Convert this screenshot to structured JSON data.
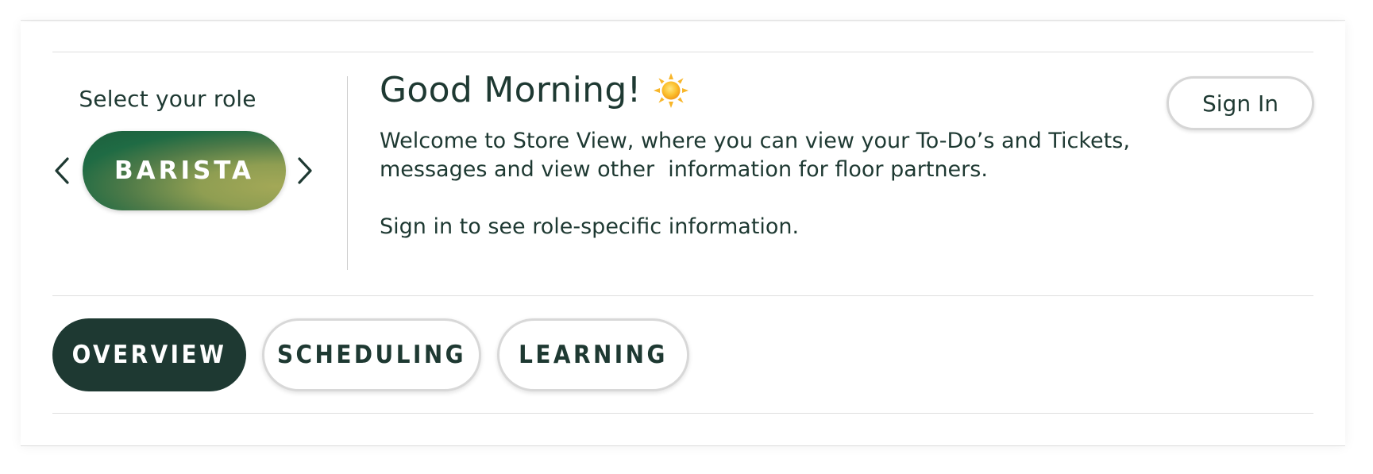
{
  "role_selector": {
    "label": "Select your role",
    "current_role": "BARISTA",
    "prev_icon": "chevron-left-icon",
    "next_icon": "chevron-right-icon"
  },
  "greeting": {
    "title": "Good Morning!",
    "icon": "sun-icon"
  },
  "welcome": {
    "line1": "Welcome to Store View, where you can view your To-Do’s and Tickets,",
    "line2": "messages and view other  information for floor partners.",
    "hint": "Sign in to see role-specific information."
  },
  "auth": {
    "sign_in_label": "Sign In"
  },
  "tabs": [
    {
      "label": "OVERVIEW",
      "active": true
    },
    {
      "label": "SCHEDULING",
      "active": false
    },
    {
      "label": "LEARNING",
      "active": false
    }
  ],
  "colors": {
    "brand_dark_green": "#1e3932",
    "brand_green": "#1d5e3c",
    "accent_olive": "#a3a857",
    "border_gray": "#d8d8d8"
  }
}
